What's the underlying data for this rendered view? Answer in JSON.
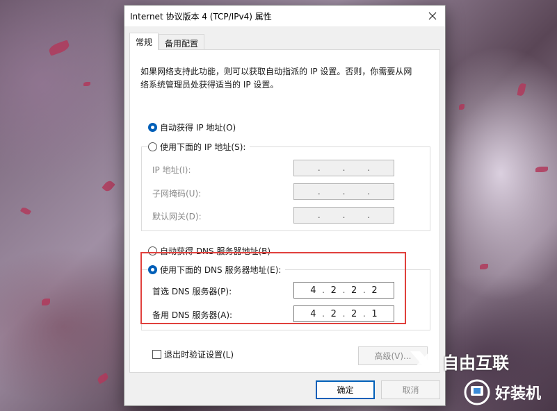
{
  "window": {
    "title": "Internet 协议版本 4 (TCP/IPv4) 属性"
  },
  "tabs": [
    {
      "label": "常规",
      "active": true
    },
    {
      "label": "备用配置",
      "active": false
    }
  ],
  "description": "如果网络支持此功能，则可以获取自动指派的 IP 设置。否则，你需要从网络系统管理员处获得适当的 IP 设置。",
  "ip": {
    "auto_label": "自动获得 IP 地址(O)",
    "manual_label": "使用下面的 IP 地址(S):",
    "auto_selected": true,
    "fields": [
      {
        "label": "IP 地址(I):"
      },
      {
        "label": "子网掩码(U):"
      },
      {
        "label": "默认网关(D):"
      }
    ]
  },
  "dns": {
    "auto_label": "自动获得 DNS 服务器地址(B)",
    "manual_label": "使用下面的 DNS 服务器地址(E):",
    "manual_selected": true,
    "preferred_label": "首选 DNS 服务器(P):",
    "preferred_value": [
      "4",
      "2",
      "2",
      "2"
    ],
    "alternate_label": "备用 DNS 服务器(A):",
    "alternate_value": [
      "4",
      "2",
      "2",
      "1"
    ]
  },
  "validate_label": "退出时验证设置(L)",
  "buttons": {
    "advanced": "高级(V)...",
    "ok": "确定",
    "cancel": "取消"
  },
  "watermark": {
    "brand1": "自由互联",
    "brand2": "好装机"
  },
  "colors": {
    "accent": "#005fb8",
    "highlight": "#e0403c"
  }
}
